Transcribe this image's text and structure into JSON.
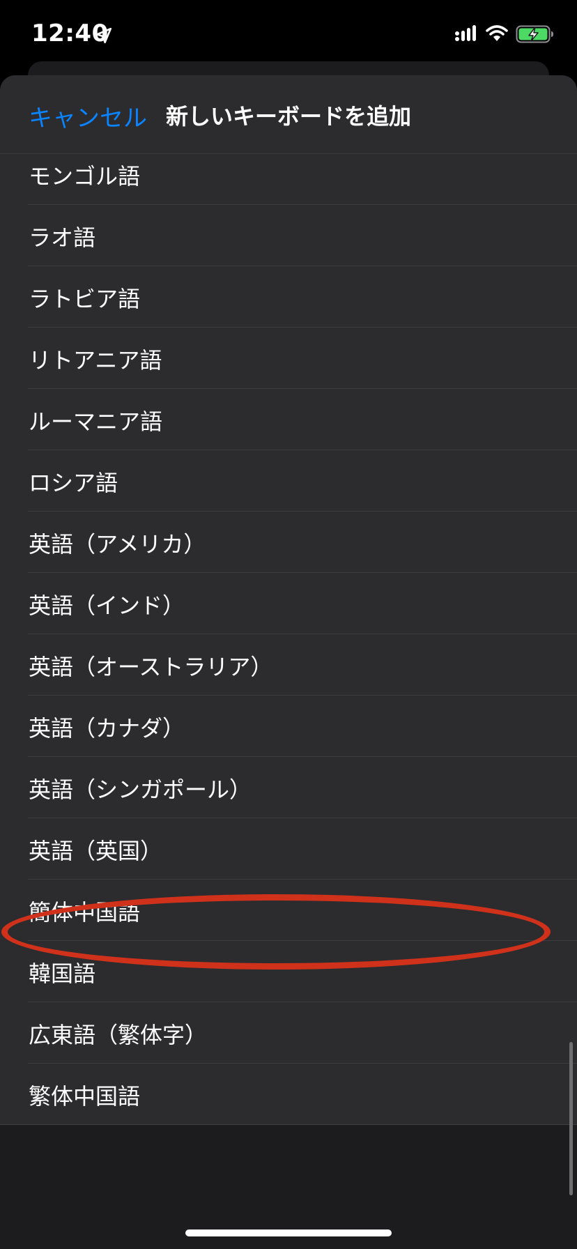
{
  "status_bar": {
    "time": "12:40",
    "icons": [
      "location-arrow-icon",
      "signal-icon",
      "wifi-icon",
      "battery-charging-icon"
    ],
    "battery_color": "#4cd964"
  },
  "nav": {
    "cancel_label": "キャンセル",
    "title": "新しいキーボードを追加"
  },
  "colors": {
    "accent": "#0a84ff",
    "highlight": "#d0311b",
    "sheet_background": "#1c1c1e",
    "row_background": "#2c2c2e"
  },
  "languages": [
    "モンゴル語",
    "ラオ語",
    "ラトビア語",
    "リトアニア語",
    "ルーマニア語",
    "ロシア語",
    "英語（アメリカ）",
    "英語（インド）",
    "英語（オーストラリア）",
    "英語（カナダ）",
    "英語（シンガポール）",
    "英語（英国）",
    "簡体中国語",
    "韓国語",
    "広東語（繁体字）",
    "繁体中国語"
  ],
  "highlighted_item": "簡体中国語"
}
